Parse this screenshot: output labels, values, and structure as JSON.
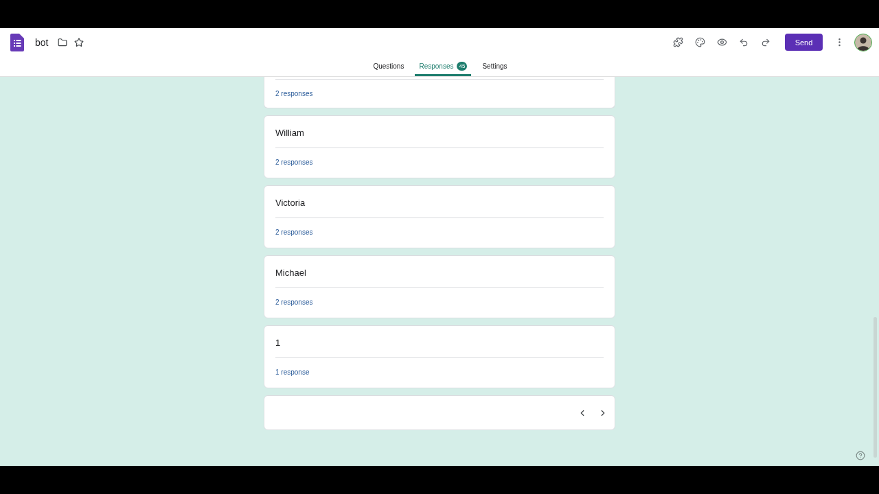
{
  "document": {
    "title": "bot"
  },
  "toolbar": {
    "send_button": "Send"
  },
  "tabs": [
    {
      "label": "Questions",
      "selected": false
    },
    {
      "label": "Responses",
      "selected": true,
      "badge": "45"
    },
    {
      "label": "Settings",
      "selected": false
    }
  ],
  "partial_card": {
    "responses": "2 responses"
  },
  "cards": [
    {
      "title": "William",
      "responses": "2 responses"
    },
    {
      "title": "Victoria",
      "responses": "2 responses"
    },
    {
      "title": "Michael",
      "responses": "2 responses"
    },
    {
      "title": "1",
      "responses": "1 response"
    }
  ]
}
